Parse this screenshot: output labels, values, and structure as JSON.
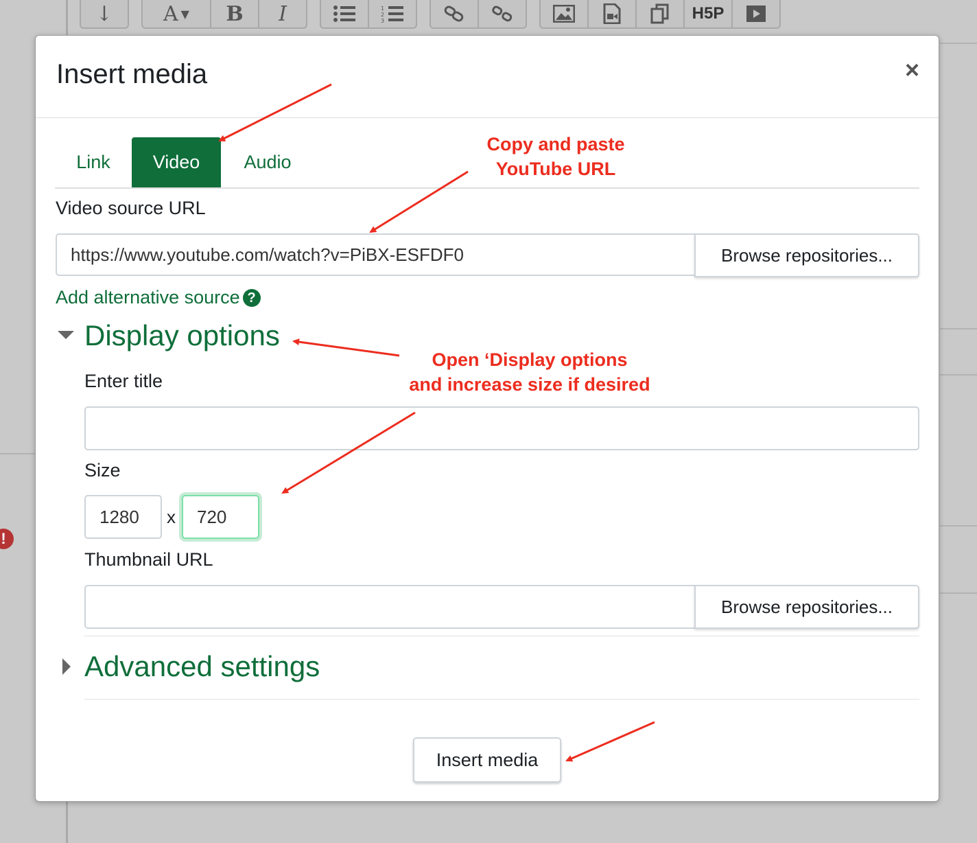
{
  "toolbar": {
    "icons": [
      "align-icon",
      "font-color-icon",
      "bold-icon",
      "italic-icon",
      "unordered-list-icon",
      "ordered-list-icon",
      "link-icon",
      "unlink-icon",
      "image-icon",
      "media-icon",
      "manage-files-icon",
      "h5p-icon",
      "record-video-icon"
    ],
    "font_glyph": "A",
    "bold_glyph": "B",
    "italic_glyph": "I",
    "h5p_label": "H5P"
  },
  "modal": {
    "title": "Insert media",
    "close_glyph": "×",
    "tabs": [
      {
        "label": "Link",
        "active": false
      },
      {
        "label": "Video",
        "active": true
      },
      {
        "label": "Audio",
        "active": false
      }
    ],
    "video_source_label": "Video source URL",
    "video_source_value": "https://www.youtube.com/watch?v=PiBX-ESFDF0",
    "browse_label": "Browse repositories...",
    "add_alt_source": "Add alternative source",
    "help_glyph": "?",
    "display_options_title": "Display options",
    "enter_title_label": "Enter title",
    "title_value": "",
    "size_label": "Size",
    "width_value": "1280",
    "size_separator": "x",
    "height_value": "720",
    "thumbnail_label": "Thumbnail URL",
    "thumbnail_value": "",
    "thumbnail_browse_label": "Browse repositories...",
    "advanced_settings_title": "Advanced settings",
    "insert_button_label": "Insert media"
  },
  "annotations": {
    "copy_paste_line1": "Copy and paste",
    "copy_paste_line2": "YouTube URL",
    "display_line1": "Open ‘Display options",
    "display_line2": "and increase size if desired"
  },
  "colors": {
    "accent_green": "#0f6e3a",
    "annotation_red": "#ec2d1f",
    "focus_green": "#7be0a8"
  },
  "warning_glyph": "!"
}
